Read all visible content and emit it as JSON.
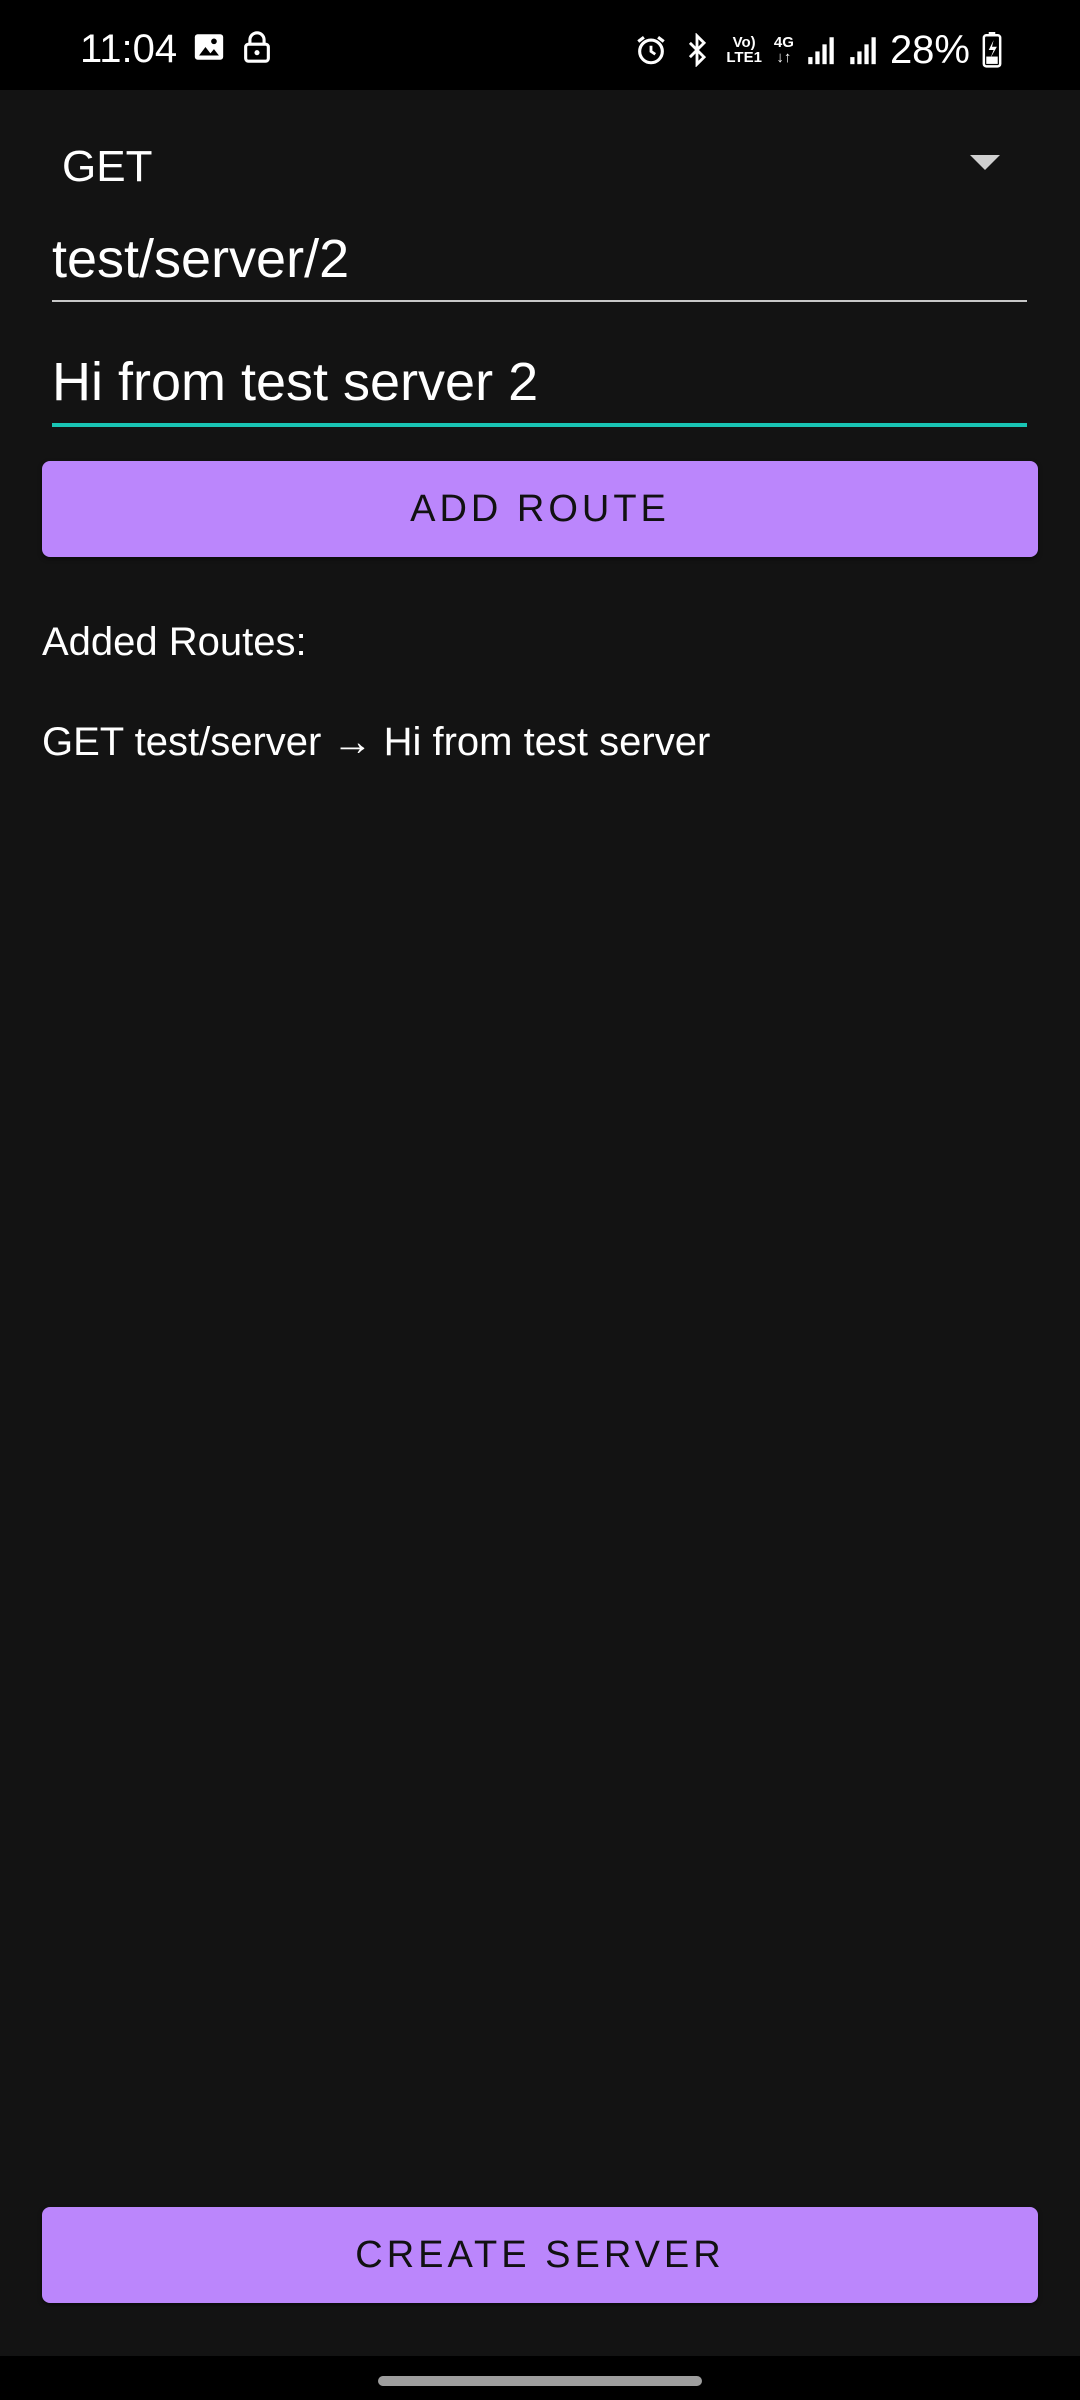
{
  "status_bar": {
    "time": "11:04",
    "battery": "28%",
    "network_top": "Vo)",
    "network_bottom": "LTE1",
    "network_type": "4G",
    "left_icons": [
      "image-icon",
      "lock-icon"
    ],
    "right_icons": [
      "alarm-icon",
      "bluetooth-icon",
      "signal-icon",
      "signal-icon",
      "battery-charging-icon"
    ]
  },
  "form": {
    "method": "GET",
    "path_value": "test/server/2",
    "response_value": "Hi from test server 2",
    "add_button_label": "ADD ROUTE"
  },
  "routes": {
    "header": "Added Routes:",
    "items": [
      "GET test/server → Hi from test server"
    ]
  },
  "footer": {
    "create_button_label": "CREATE SERVER"
  },
  "colors": {
    "background": "#131313",
    "accent": "#bb86fc",
    "focus_underline": "#19c5b4"
  }
}
